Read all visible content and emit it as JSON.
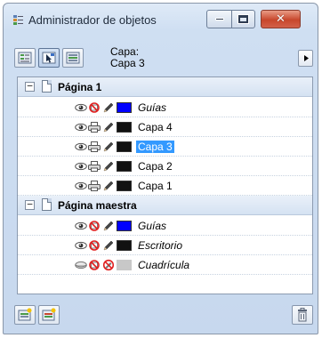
{
  "window": {
    "title": "Administrador de objetos",
    "close_glyph": "✕"
  },
  "toolbar": {
    "current_layer_label": "Capa:",
    "current_layer_value": "Capa 3",
    "buttons": [
      "show-object-properties-icon",
      "edit-across-layers-icon",
      "layer-manager-view-icon"
    ],
    "menu_arrow": "▸"
  },
  "tree": {
    "expander_glyph": "−",
    "pages": [
      {
        "name": "Página 1",
        "layers": [
          {
            "name": "Guías",
            "italic": true,
            "color": "#0000ff",
            "printable": false,
            "selected": false
          },
          {
            "name": "Capa 4",
            "italic": false,
            "color": "#111111",
            "printable": true,
            "selected": false
          },
          {
            "name": "Capa 3",
            "italic": false,
            "color": "#111111",
            "printable": true,
            "selected": true
          },
          {
            "name": "Capa 2",
            "italic": false,
            "color": "#111111",
            "printable": true,
            "selected": false
          },
          {
            "name": "Capa 1",
            "italic": false,
            "color": "#111111",
            "printable": true,
            "selected": false
          }
        ]
      },
      {
        "name": "Página maestra",
        "layers": [
          {
            "name": "Guías",
            "italic": true,
            "color": "#0000ff",
            "printable": false,
            "selected": false
          },
          {
            "name": "Escritorio",
            "italic": true,
            "color": "#111111",
            "printable": false,
            "selected": false
          },
          {
            "name": "Cuadrícula",
            "italic": true,
            "color": "#c8c8c8",
            "printable": false,
            "selected": false
          }
        ]
      }
    ]
  },
  "bottom_toolbar": {
    "buttons": [
      "new-layer-icon",
      "new-master-layer-icon",
      "delete-icon"
    ]
  },
  "colors": {
    "selection": "#3399ff",
    "guides": "#0000ff",
    "layer": "#111111",
    "grid": "#c8c8c8"
  }
}
